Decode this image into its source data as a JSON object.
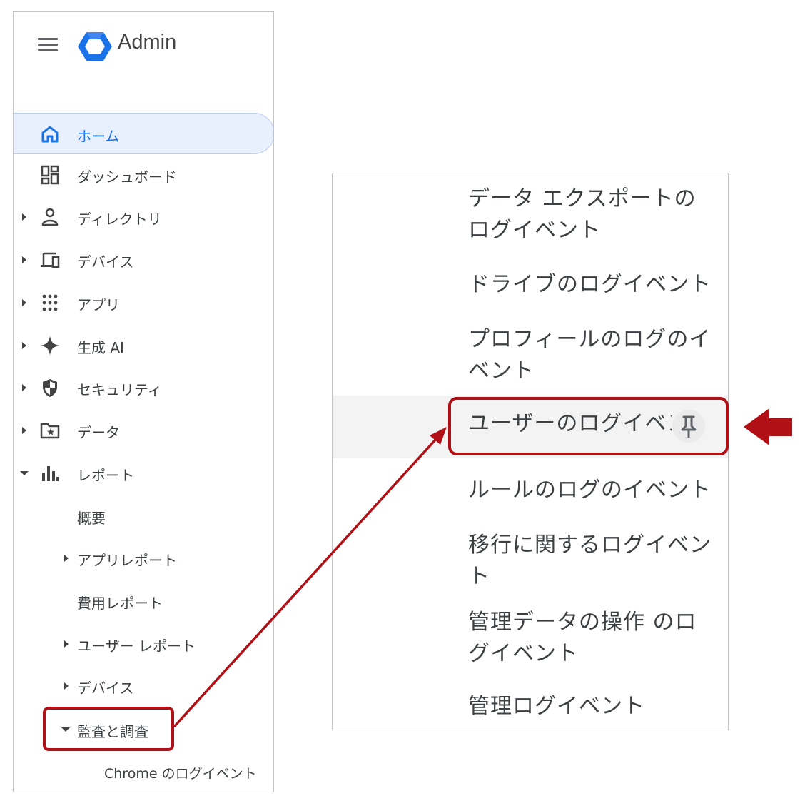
{
  "app": {
    "title": "Admin"
  },
  "sidebar": {
    "items": [
      {
        "label": "ホーム",
        "icon": "home-icon",
        "expandable": false,
        "active": true
      },
      {
        "label": "ダッシュボード",
        "icon": "dashboard-icon",
        "expandable": false
      },
      {
        "label": "ディレクトリ",
        "icon": "person-icon",
        "expandable": true
      },
      {
        "label": "デバイス",
        "icon": "devices-icon",
        "expandable": true
      },
      {
        "label": "アプリ",
        "icon": "apps-grid-icon",
        "expandable": true
      },
      {
        "label": "生成 AI",
        "icon": "sparkle-icon",
        "expandable": true
      },
      {
        "label": "セキュリティ",
        "icon": "shield-icon",
        "expandable": true
      },
      {
        "label": "データ",
        "icon": "folder-star-icon",
        "expandable": true
      },
      {
        "label": "レポート",
        "icon": "bar-chart-icon",
        "expandable": true,
        "expanded": true
      }
    ],
    "report_children": [
      {
        "label": "概要",
        "expandable": false
      },
      {
        "label": "アプリレポート",
        "expandable": true
      },
      {
        "label": "費用レポート",
        "expandable": false
      },
      {
        "label": "ユーザー レポート",
        "expandable": true
      },
      {
        "label": "デバイス",
        "expandable": true
      },
      {
        "label": "監査と調査",
        "expandable": true,
        "expanded": true
      }
    ],
    "audit_children": [
      {
        "label": "Chrome のログイベント"
      }
    ]
  },
  "log_list": {
    "items": [
      {
        "label": "データ エクスポートのログイベント"
      },
      {
        "label": "ドライブのログイベント"
      },
      {
        "label": "プロフィールのログのイベント"
      },
      {
        "label": "ユーザーのログイベント",
        "hovered": true,
        "pin_icon": "pin-icon"
      },
      {
        "label": "ルールのログのイベント"
      },
      {
        "label": "移行に関するログイベント"
      },
      {
        "label": "管理データの操作 のログイベント"
      },
      {
        "label": "管理ログイベント"
      }
    ]
  },
  "colors": {
    "highlight": "#b11116",
    "active_bg": "#e8f0fe",
    "active_text": "#1a73e8",
    "logo_blue": "#1a73e8"
  }
}
